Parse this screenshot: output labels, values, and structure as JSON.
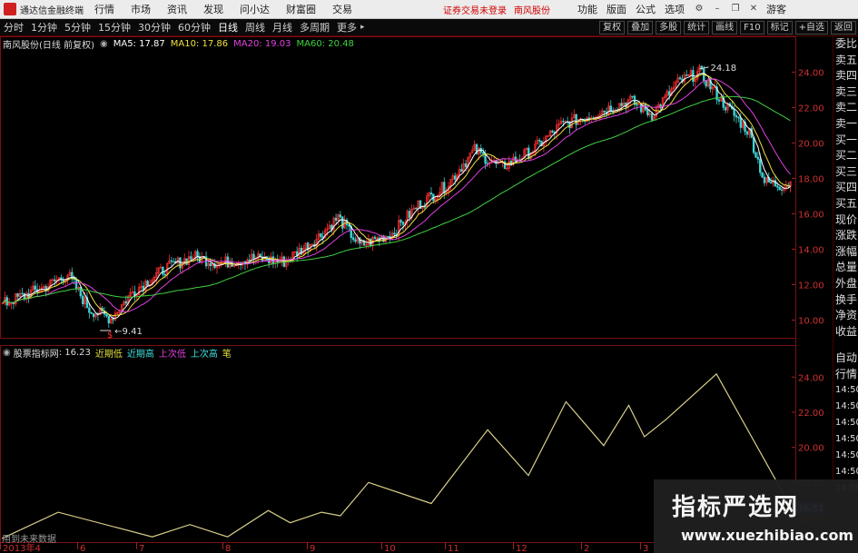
{
  "menubar": {
    "app_title": "通达信金融终端",
    "items": [
      "行情",
      "市场",
      "资讯",
      "发现",
      "问小达",
      "财富圈",
      "交易"
    ],
    "notice": "证券交易未登录",
    "stock_link": "南风股份",
    "right_items": [
      "功能",
      "版面",
      "公式",
      "选项"
    ],
    "visitor": "游客"
  },
  "periodbar": {
    "items": [
      "分时",
      "1分钟",
      "5分钟",
      "15分钟",
      "30分钟",
      "60分钟",
      "日线",
      "周线",
      "月线",
      "多周期",
      "更多"
    ],
    "active": "日线",
    "buttons": [
      "复权",
      "叠加",
      "多股",
      "统计",
      "画线",
      "F10",
      "标记",
      "+自选",
      "返回"
    ]
  },
  "info": {
    "stock": "南风股份(日线 前复权)",
    "ma5": "MA5: 17.87",
    "ma10": "MA10: 17.86",
    "ma20": "MA20: 19.03",
    "ma60": "MA60: 20.48",
    "colors": {
      "ma5": "#ffffff",
      "ma10": "#f0e040",
      "ma20": "#e040e0",
      "ma60": "#40d040"
    }
  },
  "main_chart": {
    "yticks": [
      "24.00",
      "22.00",
      "20.00",
      "18.00",
      "16.00",
      "14.00",
      "12.00",
      "10.00"
    ],
    "high_label": "24.18",
    "low_label": "9.41",
    "yrange": [
      9.0,
      25.2
    ]
  },
  "right_panel": {
    "items": [
      "委比",
      "卖五",
      "卖四",
      "卖三",
      "卖二",
      "卖一",
      "买一",
      "买二",
      "买三",
      "买四",
      "买五",
      "现价",
      "涨跌",
      "涨幅",
      "总量",
      "外盘",
      "换手",
      "净资",
      "收益"
    ],
    "lower_items": [
      "自动",
      "行情",
      "14:50",
      "14:50",
      "14:50",
      "14:50",
      "14:50",
      "14:50",
      "14:50"
    ]
  },
  "indicator": {
    "name": "股票指标网",
    "value": ": 16.23",
    "labels": [
      "近期低",
      "近期高",
      "上次低",
      "上次高",
      "笔"
    ],
    "label_colors": [
      "#e0e040",
      "#40e0e0",
      "#e040e0",
      "#40e0e0",
      "#e0e040"
    ],
    "yticks": [
      "24.00",
      "22.00",
      "20.00",
      "18.00",
      "16.00"
    ],
    "current": "16.51",
    "footnote": "用到未来数据",
    "yrange": [
      14.6,
      25.0
    ]
  },
  "xaxis": {
    "labels": [
      "2013年4",
      "6",
      "7",
      "8",
      "9",
      "10",
      "11",
      "12",
      "2",
      "3"
    ]
  },
  "watermark": {
    "title": "指标严选网",
    "url": "www.xuezhibiao.com"
  },
  "chart_data": {
    "type": "line",
    "title": "南风股份(日线 前复权)",
    "series": [
      {
        "name": "股票指标网",
        "x_index": [
          0,
          18,
          48,
          60,
          72,
          85,
          92,
          102,
          108,
          117,
          137,
          155,
          168,
          180,
          192,
          200,
          205,
          212,
          228,
          252
        ],
        "values": [
          14.8,
          16.3,
          14.9,
          15.6,
          14.9,
          16.4,
          15.7,
          16.3,
          16.1,
          18.0,
          16.8,
          21.0,
          18.4,
          22.6,
          20.1,
          22.4,
          20.6,
          21.6,
          24.18,
          16.51
        ]
      }
    ],
    "ylim": [
      14.6,
      25.0
    ]
  }
}
